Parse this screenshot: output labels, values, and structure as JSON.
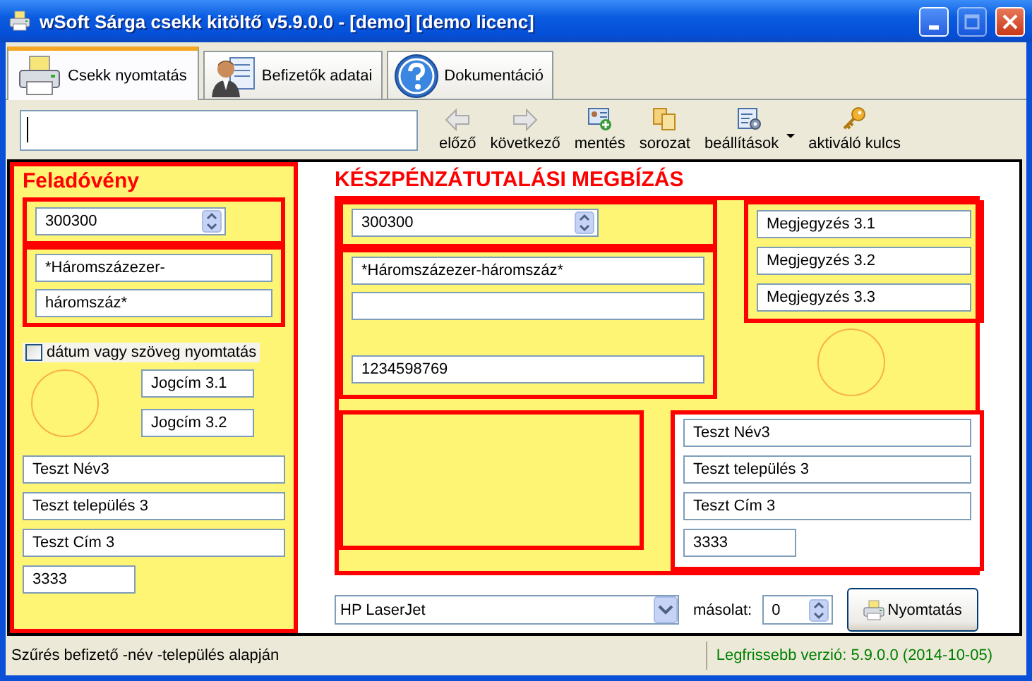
{
  "window": {
    "title": "wSoft Sárga csekk kitöltő v5.9.0.0 - [demo] [demo licenc]"
  },
  "tabs": [
    {
      "label": "Csekk nyomtatás",
      "selected": true
    },
    {
      "label": "Befizetők adatai",
      "selected": false
    },
    {
      "label": "Dokumentáció",
      "selected": false
    }
  ],
  "toolbar": {
    "buttons": [
      {
        "label": "előző",
        "dropdown": false
      },
      {
        "label": "következő",
        "dropdown": false
      },
      {
        "label": "mentés",
        "dropdown": false
      },
      {
        "label": "sorozat",
        "dropdown": false
      },
      {
        "label": "beállítások",
        "dropdown": true
      },
      {
        "label": "aktiváló kulcs",
        "dropdown": false
      }
    ]
  },
  "sender": {
    "title": "Feladóvény",
    "amount": "300300",
    "amount_words": [
      "*Háromszázezer-",
      "háromszáz*"
    ],
    "date_checkbox": {
      "label": "dátum vagy szöveg nyomtatás",
      "checked": false
    },
    "reasons": [
      "Jogcím 3.1",
      "Jogcím 3.2"
    ],
    "address": [
      "Teszt Név3",
      "Teszt település 3",
      "Teszt Cím 3"
    ],
    "postal_code": "3333"
  },
  "transfer": {
    "title": "KÉSZPÉNZÁTUTALÁSI MEGBÍZÁS",
    "amount": "300300",
    "amount_words": "*Háromszázezer-háromszáz*",
    "account": "1234598769",
    "notes": [
      "Megjegyzés 3.1",
      "Megjegyzés 3.2",
      "Megjegyzés 3.3"
    ],
    "address": [
      "Teszt Név3",
      "Teszt település 3",
      "Teszt Cím 3"
    ],
    "postal_code": "3333"
  },
  "print": {
    "printer": "HP LaserJet",
    "copies_label": "másolat:",
    "copies": "0",
    "button": "Nyomtatás"
  },
  "status_bar": {
    "left": "Szűrés befizető -név -település alapján",
    "right": "Legfrissebb verzió: 5.9.0.0 (2014-10-05)"
  }
}
